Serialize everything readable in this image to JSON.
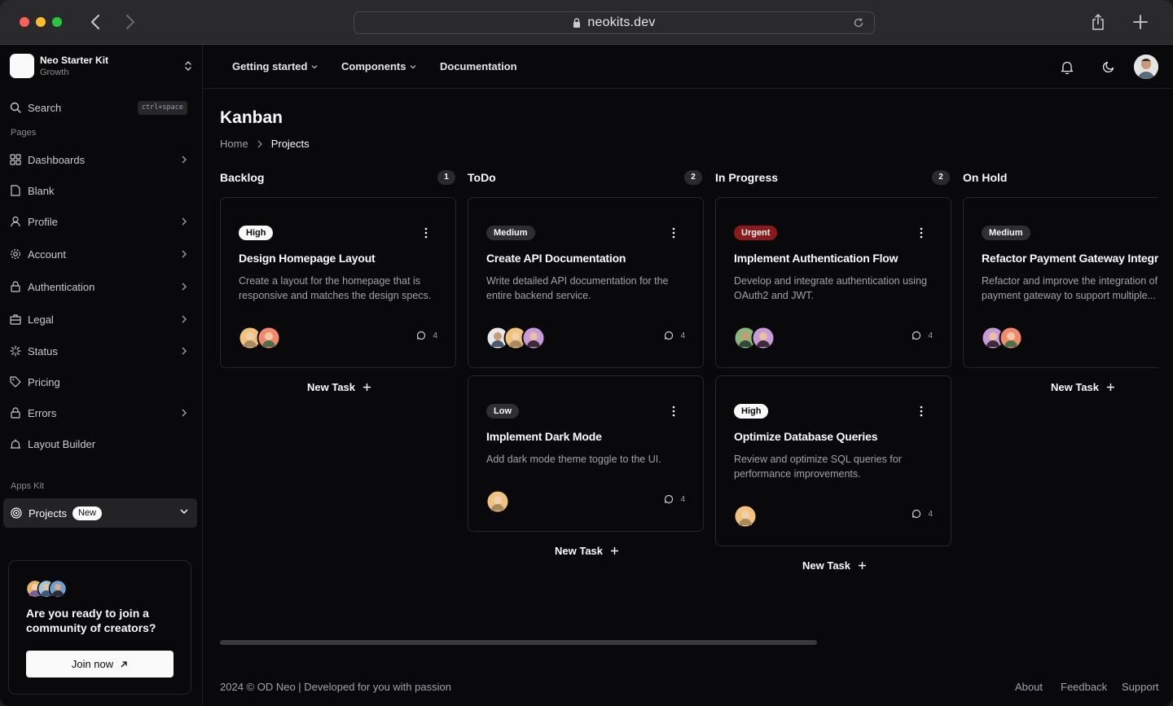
{
  "browser": {
    "url": "neokits.dev"
  },
  "brand": {
    "name": "Neo Starter Kit",
    "plan": "Growth"
  },
  "search": {
    "label": "Search",
    "shortcut": "ctrl+space"
  },
  "sidebar": {
    "pages_heading": "Pages",
    "items": [
      {
        "label": "Dashboards",
        "icon": "grid-icon",
        "has_chevron": true
      },
      {
        "label": "Blank",
        "icon": "file-icon",
        "has_chevron": false
      },
      {
        "label": "Profile",
        "icon": "user-icon",
        "has_chevron": true
      },
      {
        "label": "Account",
        "icon": "gear-icon",
        "has_chevron": true
      },
      {
        "label": "Authentication",
        "icon": "lock-icon",
        "has_chevron": true
      },
      {
        "label": "Legal",
        "icon": "briefcase-icon",
        "has_chevron": true
      },
      {
        "label": "Status",
        "icon": "loader-icon",
        "has_chevron": true
      },
      {
        "label": "Pricing",
        "icon": "tag-icon",
        "has_chevron": false
      },
      {
        "label": "Errors",
        "icon": "lock-icon",
        "has_chevron": true
      },
      {
        "label": "Layout Builder",
        "icon": "layout-icon",
        "has_chevron": false
      }
    ],
    "apps_heading": "Apps Kit",
    "projects": {
      "label": "Projects",
      "badge": "New"
    }
  },
  "cta": {
    "title": "Are you ready to join a community of creators?",
    "button": "Join now"
  },
  "topnav": {
    "getting_started": "Getting started",
    "components": "Components",
    "documentation": "Documentation"
  },
  "page": {
    "title": "Kanban",
    "breadcrumb_home": "Home",
    "breadcrumb_current": "Projects"
  },
  "columns": [
    {
      "title": "Backlog",
      "count": "1",
      "new_task": "New Task"
    },
    {
      "title": "ToDo",
      "count": "2",
      "new_task": "New Task"
    },
    {
      "title": "In Progress",
      "count": "2",
      "new_task": "New Task"
    },
    {
      "title": "On Hold",
      "count": "",
      "new_task": "New Task"
    }
  ],
  "cards": [
    {
      "priority": "High",
      "title": "Design Homepage Layout",
      "desc": "Create a layout for the homepage that is responsive and matches the design specs.",
      "comments": "4"
    },
    {
      "priority": "Medium",
      "title": "Create API Documentation",
      "desc": "Write detailed API documentation for the entire backend service.",
      "comments": "4"
    },
    {
      "priority": "Low",
      "title": "Implement Dark Mode",
      "desc": "Add dark mode theme toggle to the UI.",
      "comments": "4"
    },
    {
      "priority": "Urgent",
      "title": "Implement Authentication Flow",
      "desc": "Develop and integrate authentication using OAuth2 and JWT.",
      "comments": "4"
    },
    {
      "priority": "High",
      "title": "Optimize Database Queries",
      "desc": "Review and optimize SQL queries for performance improvements.",
      "comments": "4"
    },
    {
      "priority": "Medium",
      "title": "Refactor Payment Gateway Integration",
      "desc": "Refactor and improve the integration of payment gateway to support multiple...",
      "comments": ""
    }
  ],
  "footer": {
    "copyright": "2024 © OD Neo | Developed for you with passion",
    "about": "About",
    "feedback": "Feedback",
    "support": "Support"
  },
  "colors": {
    "background": "#09090b",
    "border": "#26262a",
    "urgent": "#8b1a1a",
    "accent_white": "#fafafa"
  }
}
